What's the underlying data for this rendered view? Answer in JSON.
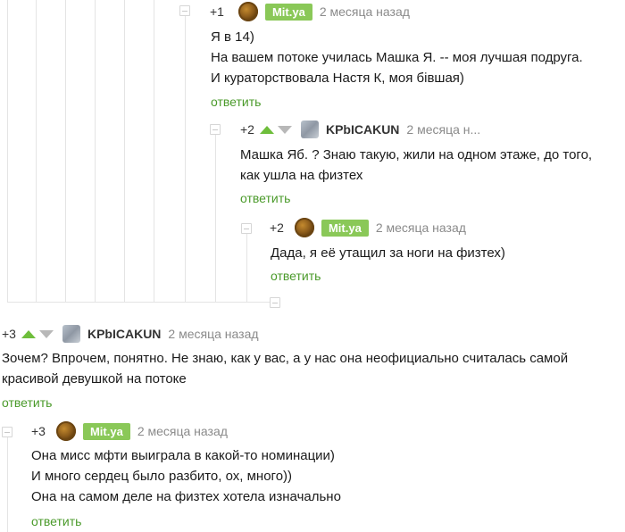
{
  "comments": [
    {
      "rating": "+1",
      "author": "Mit.ya",
      "time": "2 месяца назад",
      "lines": [
        "Я в 14)",
        "На вашем потоке училась Машка Я. -- моя лучшая подруга.",
        "И кураторствовала Настя К, моя бівшая)"
      ],
      "reply": "ответить"
    },
    {
      "rating": "+2",
      "author": "KPbICAKUN",
      "time": "2 месяца н...",
      "lines": [
        "Машка Яб. ? Знаю такую, жили на одном этаже, до того,",
        "как ушла на физтех"
      ],
      "reply": "ответить"
    },
    {
      "rating": "+2",
      "author": "Mit.ya",
      "time": "2 месяца назад",
      "lines": [
        "Дада, я её утащил за ноги на физтех)"
      ],
      "reply": "ответить"
    },
    {
      "rating": "+3",
      "author": "KPbICAKUN",
      "time": "2 месяца назад",
      "lines": [
        "Зочем? Впрочем, понятно. Не знаю, как у вас, а у нас она неофициально считалась самой",
        "красивой девушкой на потоке"
      ],
      "reply": "ответить"
    },
    {
      "rating": "+3",
      "author": "Mit.ya",
      "time": "2 месяца назад",
      "lines": [
        "Она мисс мфти выиграла в какой-то номинации)",
        "И много сердец было разбито, ох, много))",
        "Она на самом деле на физтех хотела изначально"
      ],
      "reply": "ответить"
    }
  ],
  "colors": {
    "accent_green": "#8ac858",
    "vote_up": "#6ebe3b",
    "vote_down": "#b8b8b8",
    "reply_link": "#4a9a2a",
    "meta_grey": "#8a8a8a",
    "thread_line": "#e4e4e4"
  },
  "icons": [
    "collapse-icon",
    "vote-up-icon",
    "vote-down-icon",
    "avatar"
  ]
}
